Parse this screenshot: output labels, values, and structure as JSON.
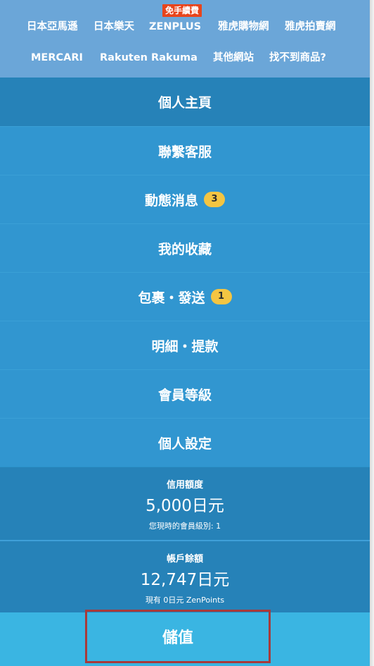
{
  "top_links": {
    "row1": [
      "日本亞馬遜",
      "日本樂天",
      "ZENPLUS",
      "雅虎購物網",
      "雅虎拍賣網"
    ],
    "row2": [
      "MERCARI",
      "Rakuten Rakuma",
      "其他網站",
      "找不到商品?"
    ],
    "promo_badge": "免手續費"
  },
  "menu": [
    {
      "label": "個人主頁"
    },
    {
      "label": "聯繫客服"
    },
    {
      "label": "動態消息",
      "badge": "3"
    },
    {
      "label": "我的收藏"
    },
    {
      "label": "包裹・發送",
      "badge": "1"
    },
    {
      "label": "明細・提款"
    },
    {
      "label": "會員等級"
    },
    {
      "label": "個人設定"
    }
  ],
  "credit": {
    "label": "信用額度",
    "amount": "5,000日元",
    "sub": "您現時的會員級別: 1"
  },
  "balance": {
    "label": "帳戶餘額",
    "amount": "12,747日元",
    "sub": "現有 0日元 ZenPoints"
  },
  "deposit": {
    "label": "儲值"
  },
  "colors": {
    "top_bar": "#6ba6d8",
    "menu_bg": "#3196d0",
    "home_bg": "#2682b8",
    "deposit_bg": "#3ab5e2",
    "badge_bg": "#f4c542",
    "promo_bg": "#e8451c",
    "highlight_border": "#a83a3a"
  }
}
